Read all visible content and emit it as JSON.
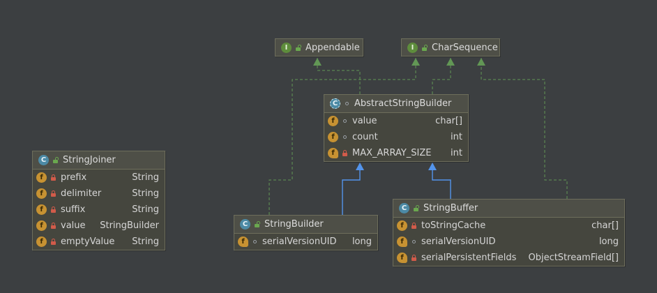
{
  "diagram": {
    "interfaces": {
      "appendable": {
        "badge": "I",
        "name": "Appendable"
      },
      "charsequence": {
        "badge": "I",
        "name": "CharSequence"
      }
    },
    "classes": {
      "abstractstringbuilder": {
        "badge": "C",
        "name": "AbstractStringBuilder",
        "fields": [
          {
            "badge": "f",
            "visibility": "package",
            "name": "value",
            "type": "char[]"
          },
          {
            "badge": "f",
            "visibility": "package",
            "name": "count",
            "type": "int"
          },
          {
            "badge": "f",
            "visibility": "private",
            "name": "MAX_ARRAY_SIZE",
            "type": "int"
          }
        ]
      },
      "stringjoiner": {
        "badge": "C",
        "name": "StringJoiner",
        "fields": [
          {
            "badge": "f",
            "visibility": "private",
            "name": "prefix",
            "type": "String"
          },
          {
            "badge": "f",
            "visibility": "private",
            "name": "delimiter",
            "type": "String"
          },
          {
            "badge": "f",
            "visibility": "private",
            "name": "suffix",
            "type": "String"
          },
          {
            "badge": "f",
            "visibility": "private",
            "name": "value",
            "type": "StringBuilder"
          },
          {
            "badge": "f",
            "visibility": "private",
            "name": "emptyValue",
            "type": "String"
          }
        ]
      },
      "stringbuilder": {
        "badge": "C",
        "name": "StringBuilder",
        "fields": [
          {
            "badge": "f",
            "visibility": "package",
            "name": "serialVersionUID",
            "type": "long"
          }
        ]
      },
      "stringbuffer": {
        "badge": "C",
        "name": "StringBuffer",
        "fields": [
          {
            "badge": "f",
            "visibility": "private",
            "name": "toStringCache",
            "type": "char[]"
          },
          {
            "badge": "f",
            "visibility": "package",
            "name": "serialVersionUID",
            "type": "long"
          },
          {
            "badge": "f",
            "visibility": "private",
            "name": "serialPersistentFields",
            "type": "ObjectStreamField[]"
          }
        ]
      }
    },
    "colors": {
      "background": "#3c3f41",
      "node_fill": "#45463e",
      "implements_edge": "#629755",
      "extends_edge": "#5394ec"
    }
  }
}
